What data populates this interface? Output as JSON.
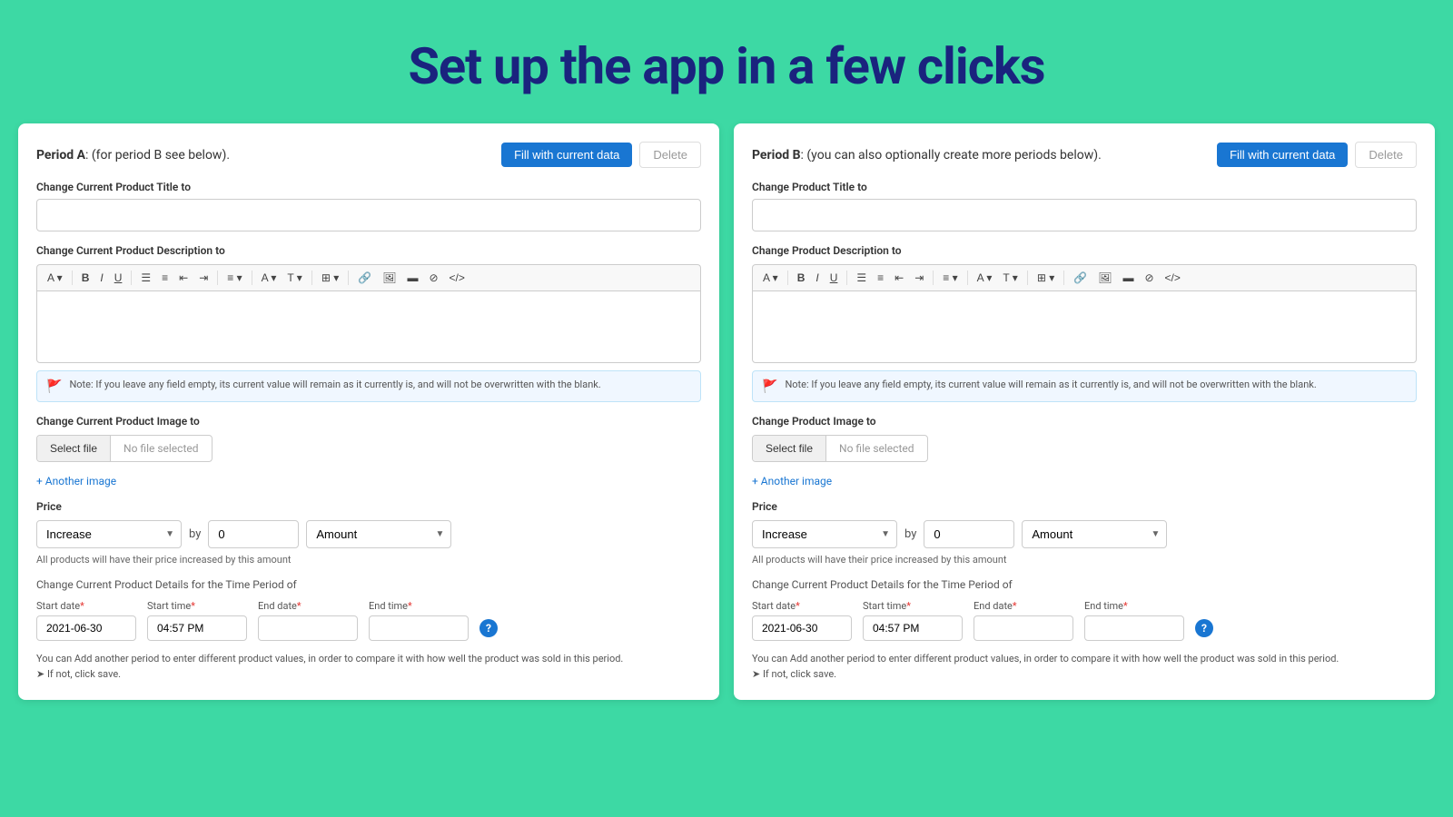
{
  "header": {
    "title": "Set up the app in a few clicks",
    "background_color": "#3dd9a4"
  },
  "panel_a": {
    "title_prefix": "Period A",
    "title_suffix": ": (for period B see below).",
    "fill_button_label": "Fill with current data",
    "delete_button_label": "Delete",
    "change_title_label": "Change Current Product Title to",
    "change_description_label": "Change Current Product Description to",
    "note_text": "Note: If you leave any field empty, its current value will remain as it currently is, and will not be overwritten with the blank.",
    "change_image_label": "Change Current Product Image to",
    "select_file_label": "Select file",
    "no_file_label": "No file selected",
    "add_image_label": "+ Another image",
    "price_label": "Price",
    "increase_label": "Increase",
    "by_label": "by",
    "price_value": "0",
    "amount_label": "Amount",
    "price_help": "All products will have their price increased by this amount",
    "time_period_label": "Change Current Product Details for the Time Period of",
    "start_date_label": "Start date",
    "start_date_required": "*",
    "start_date_value": "2021-06-30",
    "start_time_label": "Start time",
    "start_time_required": "*",
    "start_time_value": "04:57 PM",
    "end_date_label": "End date",
    "end_date_required": "*",
    "end_date_value": "",
    "end_time_label": "End time",
    "end_time_required": "*",
    "end_time_value": "",
    "bottom_note": "You can Add another period to enter different product values, in order to compare it with how well the product was sold in this period.",
    "bottom_note2": "➤ If not, click save."
  },
  "panel_b": {
    "title_prefix": "Period B",
    "title_suffix": ": (you can also optionally create more periods below).",
    "fill_button_label": "Fill with current data",
    "delete_button_label": "Delete",
    "change_title_label": "Change Product Title to",
    "change_description_label": "Change Product Description to",
    "note_text": "Note: If you leave any field empty, its current value will remain as it currently is, and will not be overwritten with the blank.",
    "change_image_label": "Change Product Image to",
    "select_file_label": "Select file",
    "no_file_label": "No file selected",
    "add_image_label": "+ Another image",
    "price_label": "Price",
    "increase_label": "Increase",
    "by_label": "by",
    "price_value": "0",
    "amount_label": "Amount",
    "price_help": "All products will have their price increased by this amount",
    "time_period_label": "Change Current Product Details for the Time Period of",
    "start_date_label": "Start date",
    "start_date_required": "*",
    "start_date_value": "2021-06-30",
    "start_time_label": "Start time",
    "start_time_required": "*",
    "start_time_value": "04:57 PM",
    "end_date_label": "End date",
    "end_date_required": "*",
    "end_date_value": "",
    "end_time_label": "End time",
    "end_time_required": "*",
    "end_time_value": "",
    "bottom_note": "You can Add another period to enter different product values, in order to compare it with how well the product was sold in this period.",
    "bottom_note2": "➤ If not, click save."
  },
  "toolbar_items": [
    "A▾",
    "B",
    "I",
    "U",
    "≡",
    "1.",
    "⇤",
    "⇥",
    "≡▾",
    "A▾",
    "T▾",
    "⊞▾",
    "🔗",
    "🖼",
    "▬",
    "⊘",
    "</>"
  ],
  "toolbar_items_b": [
    "A▾",
    "B",
    "I",
    "U",
    "≡",
    "1.",
    "⇤",
    "⇥",
    "≡▾",
    "A▾",
    "T▾",
    "⊞▾",
    "🔗",
    "🖼",
    "▬",
    "⊘",
    "</>"
  ]
}
